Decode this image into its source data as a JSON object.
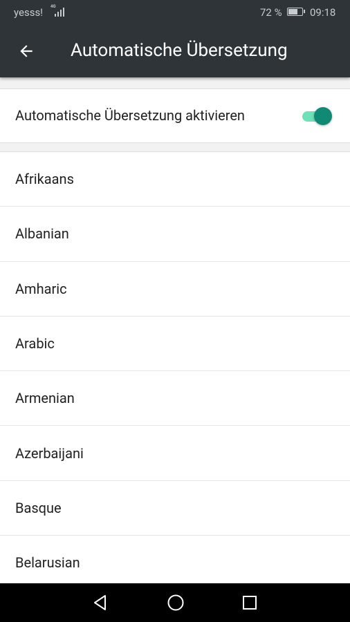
{
  "status_bar": {
    "carrier": "yesss!",
    "network_type": "4G",
    "battery_percent": "72 %",
    "battery_level": 0.72,
    "time": "09:18"
  },
  "toolbar": {
    "title": "Automatische Übersetzung",
    "back_icon": "arrow-back-icon"
  },
  "settings": {
    "auto_translate": {
      "label": "Automatische Übersetzung aktivieren",
      "enabled": true
    }
  },
  "languages": [
    "Afrikaans",
    "Albanian",
    "Amharic",
    "Arabic",
    "Armenian",
    "Azerbaijani",
    "Basque",
    "Belarusian"
  ],
  "nav_bar": {
    "icons": [
      "nav-back-icon",
      "nav-home-icon",
      "nav-recents-icon"
    ]
  },
  "colors": {
    "toolbar_bg": "#2f3439",
    "switch_thumb": "#0f8a74",
    "switch_track": "#6fe0b8",
    "background": "#f2f2f2"
  }
}
